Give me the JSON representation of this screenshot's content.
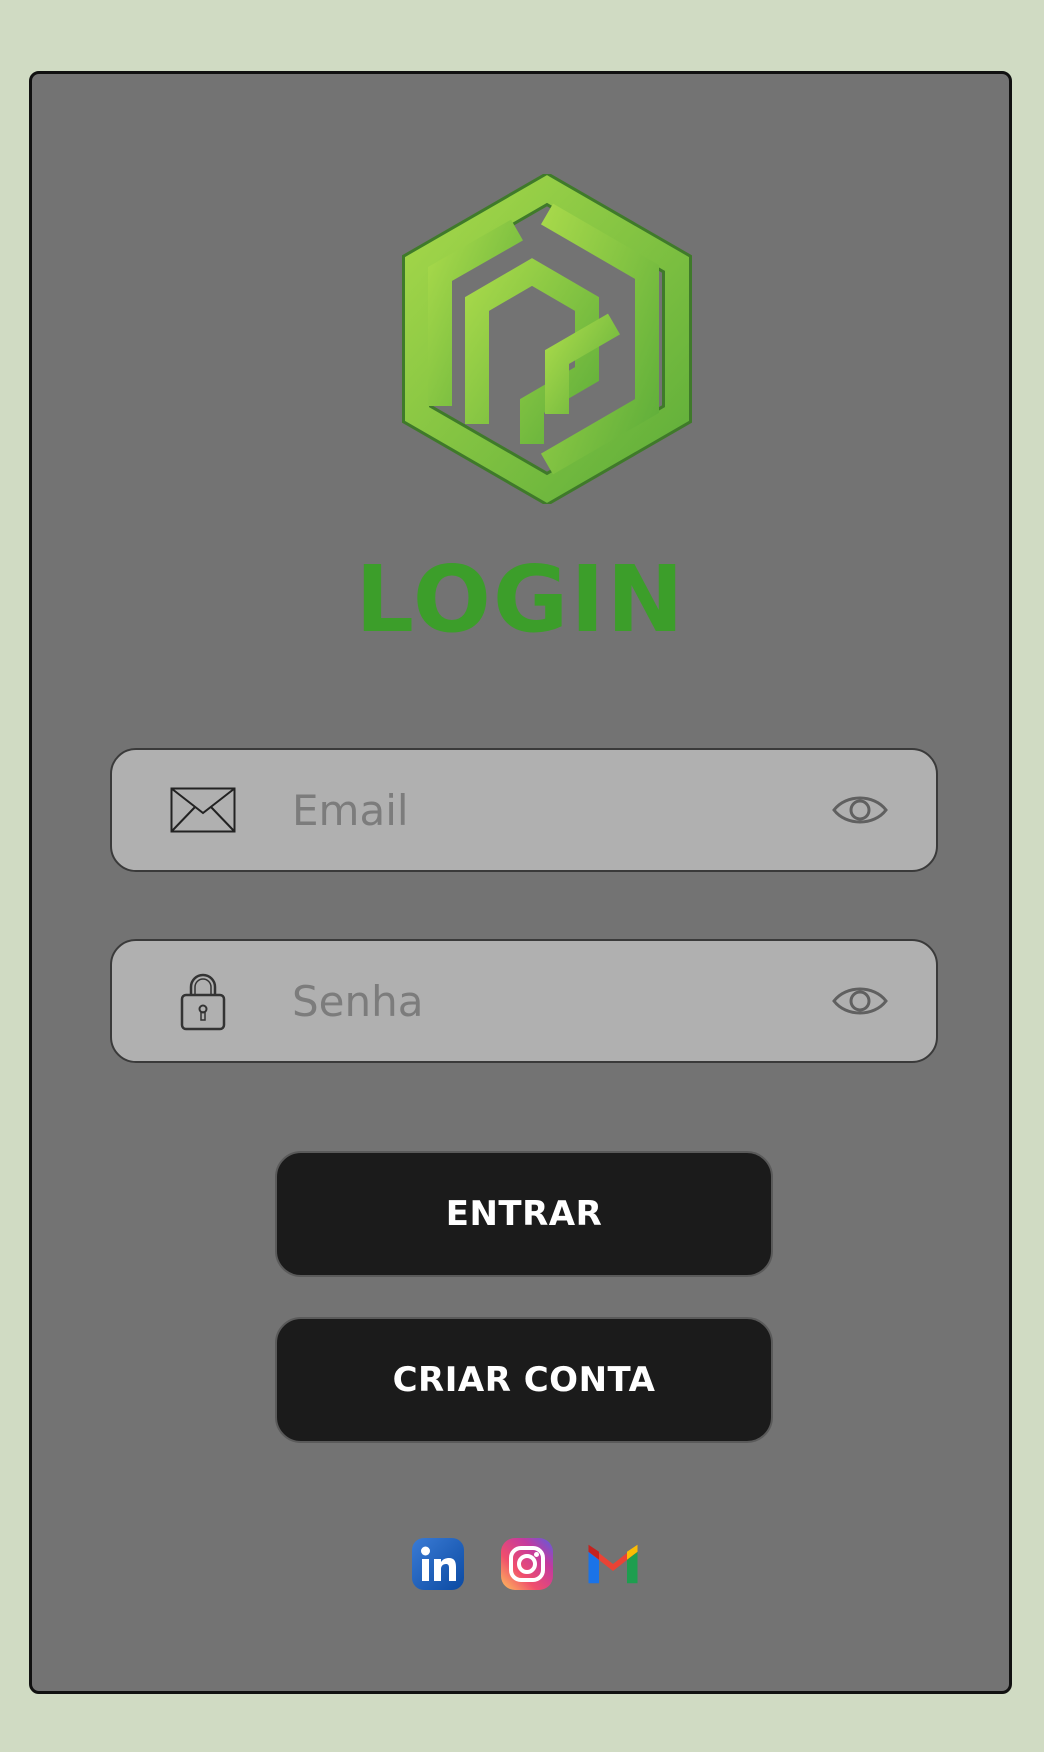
{
  "login": {
    "title": "LOGIN",
    "email_placeholder": "Email",
    "password_placeholder": "Senha",
    "enter_label": "ENTRAR",
    "create_account_label": "CRIAR CONTA"
  },
  "icons": {
    "logo": "hexagon-maze-logo",
    "email": "envelope-icon",
    "password": "lock-icon",
    "visibility": "eye-icon",
    "social": [
      "linkedin-icon",
      "instagram-icon",
      "gmail-icon"
    ]
  },
  "colors": {
    "page_background": "#d0dbc3",
    "card_background": "#737373",
    "title": "#3c9e2a",
    "field_background": "#b0b0b0",
    "button_background": "#1b1b1b",
    "button_text": "#ffffff"
  }
}
